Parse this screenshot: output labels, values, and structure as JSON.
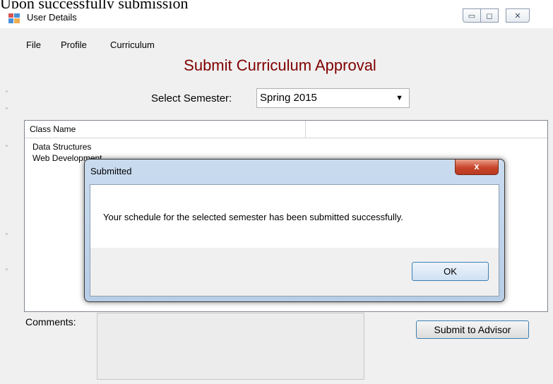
{
  "caption": "Upon successfully submission",
  "window": {
    "title": "User Details",
    "controls": {
      "minimize": "▭",
      "maximize": "◻",
      "close": "✕"
    }
  },
  "menu": [
    "File",
    "Profile",
    "Curriculum"
  ],
  "heading": "Submit Curriculum Approval",
  "semester": {
    "label": "Select Semester:",
    "value": "Spring 2015",
    "arrow": "▼"
  },
  "classes": {
    "column_header": "Class Name",
    "rows": [
      "Data Structures",
      "Web Development"
    ]
  },
  "comments": {
    "label": "Comments:",
    "value": ""
  },
  "submit_button": "Submit to Advisor",
  "dialog": {
    "title": "Submitted",
    "close_glyph": "x",
    "message": "Your schedule for the selected semester has been submitted successfully.",
    "ok_label": "OK"
  },
  "colors": {
    "heading": "#800000",
    "dialog_close": "#c7442a",
    "button_border": "#3c7fb1"
  }
}
